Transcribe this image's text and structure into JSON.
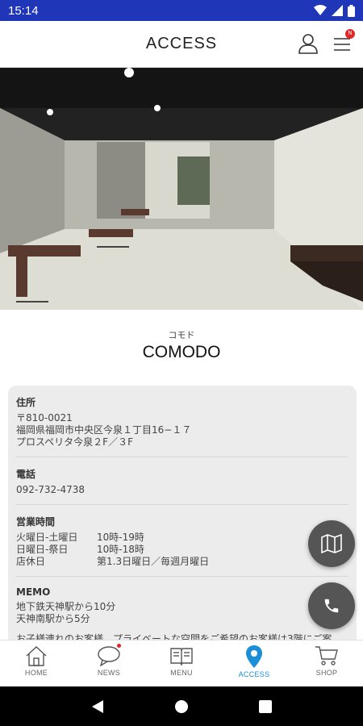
{
  "status_bar": {
    "time": "15:14"
  },
  "header": {
    "title": "ACCESS",
    "notification_badge": "N"
  },
  "shop": {
    "kana": "コモド",
    "name": "COMODO"
  },
  "info": {
    "address": {
      "label": "住所",
      "lines": [
        "〒810-0021",
        "福岡県福岡市中央区今泉１丁目16−１７",
        "プロスペリタ今泉２F／３F"
      ]
    },
    "phone": {
      "label": "電話",
      "value": "092-732-4738"
    },
    "hours": {
      "label": "営業時間",
      "rows": [
        {
          "day": "火曜日-土曜日",
          "time": "10時-19時"
        },
        {
          "day": "日曜日-祭日",
          "time": "10時-18時"
        },
        {
          "day": "店休日",
          "time": "第1.3日曜日／毎週月曜日"
        }
      ]
    },
    "memo": {
      "label": "MEMO",
      "lines": [
        "地下鉄天神駅から10分",
        "天神南駅から5分",
        "お子様連れのお客様、プライベートな空間をご希望のお客様は3階にご案"
      ]
    }
  },
  "tabs": [
    {
      "label": "HOME",
      "icon": "home-icon",
      "active": false
    },
    {
      "label": "NEWS",
      "icon": "chat-bubble-icon",
      "active": false
    },
    {
      "label": "MENU",
      "icon": "book-icon",
      "active": false
    },
    {
      "label": "ACCESS",
      "icon": "map-pin-icon",
      "active": true
    },
    {
      "label": "SHOP",
      "icon": "cart-icon",
      "active": false
    }
  ],
  "colors": {
    "status_bar": "#1f36b8",
    "accent": "#1a8fd8",
    "fab": "#555555",
    "card": "#ececec"
  }
}
